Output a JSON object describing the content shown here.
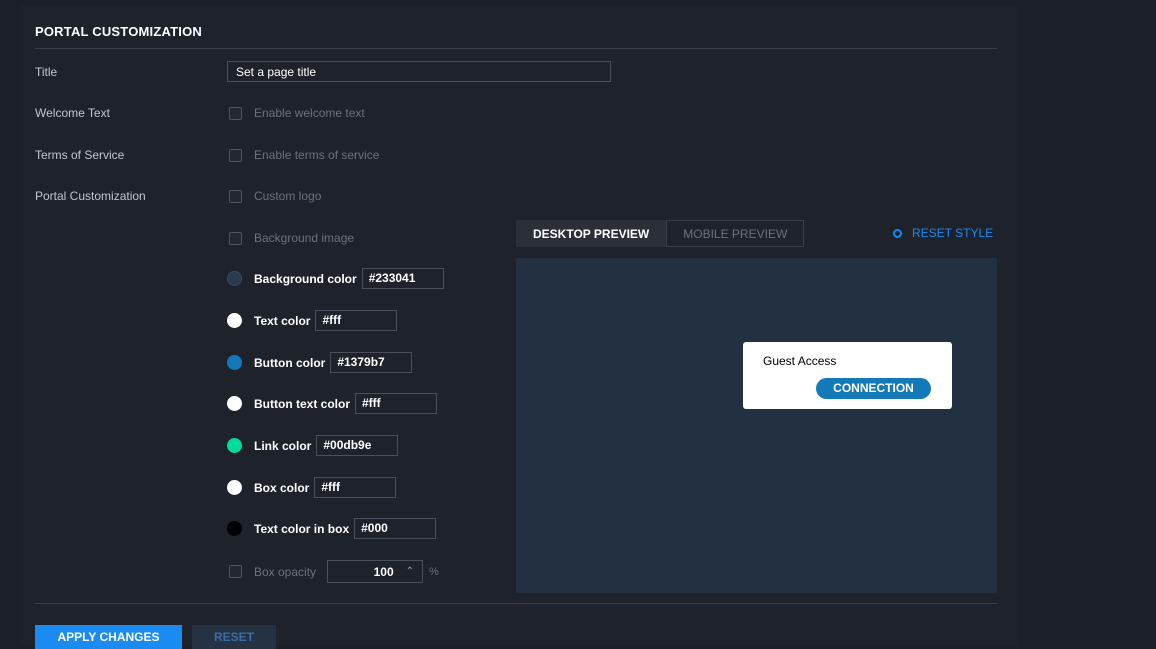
{
  "section": {
    "title": "PORTAL CUSTOMIZATION"
  },
  "rows": {
    "title_label": "Title",
    "welcome_label": "Welcome Text",
    "tos_label": "Terms of Service",
    "portal_label": "Portal Customization"
  },
  "title_input": {
    "value": "Set a page title"
  },
  "checkboxes": {
    "welcome": "Enable welcome text",
    "tos": "Enable terms of service",
    "logo": "Custom logo",
    "bg_image": "Background image"
  },
  "colors": [
    {
      "label": "Background color",
      "value": "#233041",
      "swatch": "#233041"
    },
    {
      "label": "Text color",
      "value": "#fff",
      "swatch": "#ffffff"
    },
    {
      "label": "Button color",
      "value": "#1379b7",
      "swatch": "#1379b7"
    },
    {
      "label": "Button text color",
      "value": "#fff",
      "swatch": "#ffffff"
    },
    {
      "label": "Link color",
      "value": "#00db9e",
      "swatch": "#00db9e"
    },
    {
      "label": "Box color",
      "value": "#fff",
      "swatch": "#ffffff"
    },
    {
      "label": "Text color in box",
      "value": "#000",
      "swatch": "#000000"
    }
  ],
  "opacity": {
    "label": "Box opacity",
    "value": "100",
    "unit": "%"
  },
  "preview": {
    "tab_desktop": "DESKTOP PREVIEW",
    "tab_mobile": "MOBILE PREVIEW",
    "reset_style": "RESET STYLE",
    "box_title": "Guest Access",
    "button": "CONNECTION"
  },
  "actions": {
    "apply": "APPLY CHANGES",
    "reset": "RESET"
  }
}
